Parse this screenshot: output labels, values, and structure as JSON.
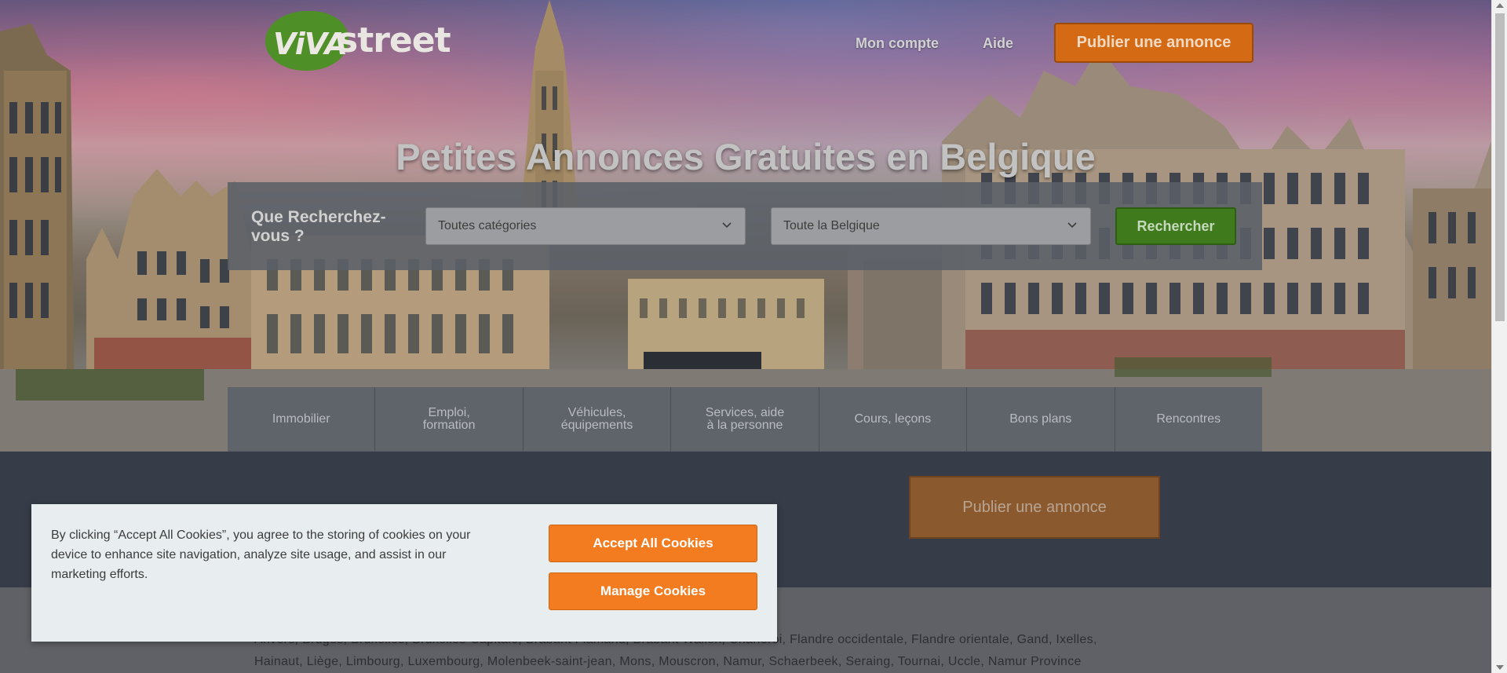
{
  "header": {
    "logo_viva": "ViVA",
    "logo_street": "street",
    "nav": {
      "account": "Mon compte",
      "help": "Aide"
    },
    "publish_label": "Publier une annonce"
  },
  "hero": {
    "title": "Petites Annonces Gratuites en Belgique",
    "search": {
      "label": "Que Recherchez-vous ?",
      "category_value": "Toutes catégories",
      "location_value": "Toute la Belgique",
      "button_label": "Rechercher"
    }
  },
  "categories": [
    {
      "label": "Immobilier"
    },
    {
      "label": "Emploi, formation"
    },
    {
      "label": "Véhicules, équipements"
    },
    {
      "label": "Services, aide à la personne"
    },
    {
      "label": "Cours, leçons"
    },
    {
      "label": "Bons plans"
    },
    {
      "label": "Rencontres"
    }
  ],
  "band": {
    "publish_label": "Publier une annonce"
  },
  "locations": {
    "line1": "Anvers, Bruges, Bruxelles, Bruxelles-Capitale, Brabant Flamand, Brabant Wallon, Charleroi, Flandre occidentale, Flandre orientale, Gand, Ixelles,",
    "line2": "Hainaut, Liège, Limbourg, Luxembourg, Molenbeek-saint-jean, Mons, Mouscron, Namur, Schaerbeek, Seraing, Tournai, Uccle, Namur Province"
  },
  "cookie": {
    "text": "By clicking “Accept All Cookies”, you agree to the storing of cookies on your device to enhance site navigation, analyze site usage, and assist in our marketing efforts.",
    "accept_label": "Accept All Cookies",
    "manage_label": "Manage Cookies"
  },
  "colors": {
    "publish_orange": "#d56a14",
    "search_green": "#3f7a1d",
    "cookie_orange": "#f47c20",
    "band_dark": "#363c48"
  }
}
